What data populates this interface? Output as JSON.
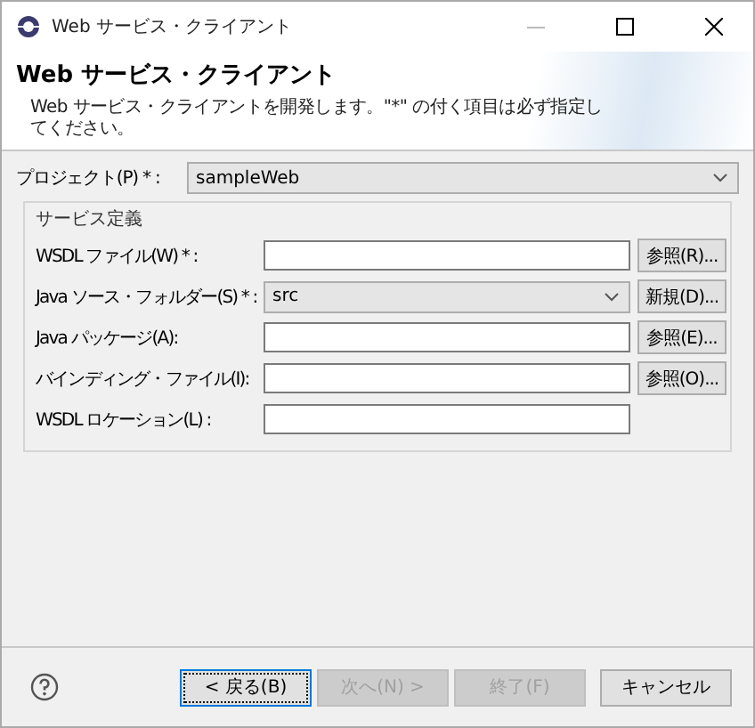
{
  "window": {
    "title": "Web サービス・クライアント"
  },
  "header": {
    "title": "Web サービス・クライアント",
    "description": "Web サービス・クライアントを開発します。\"*\" の付く項目は必ず指定してください。"
  },
  "project": {
    "label": "プロジェクト(P) * :",
    "value": "sampleWeb"
  },
  "group": {
    "title": "サービス定義",
    "rows": [
      {
        "kind": "text",
        "label": "WSDL ファイル(W) * :",
        "button": "参照(R)..."
      },
      {
        "kind": "combo",
        "label": "Java ソース・フォルダー(S) * :",
        "value": "src",
        "button": "新規(D)..."
      },
      {
        "kind": "text",
        "label": "Java パッケージ(A):",
        "button": "参照(E)..."
      },
      {
        "kind": "text",
        "label": "バインディング・ファイル(I):",
        "button": "参照(O)..."
      },
      {
        "kind": "text",
        "label": "WSDL ロケーション(L) :"
      }
    ]
  },
  "buttons": [
    {
      "label": "< 戻る(B)",
      "disabled": false,
      "focused": true
    },
    {
      "label": "次へ(N) >",
      "disabled": true,
      "focused": false
    },
    {
      "label": "終了(F)",
      "disabled": true,
      "focused": false
    },
    {
      "label": "キャンセル",
      "disabled": false,
      "focused": false
    }
  ]
}
